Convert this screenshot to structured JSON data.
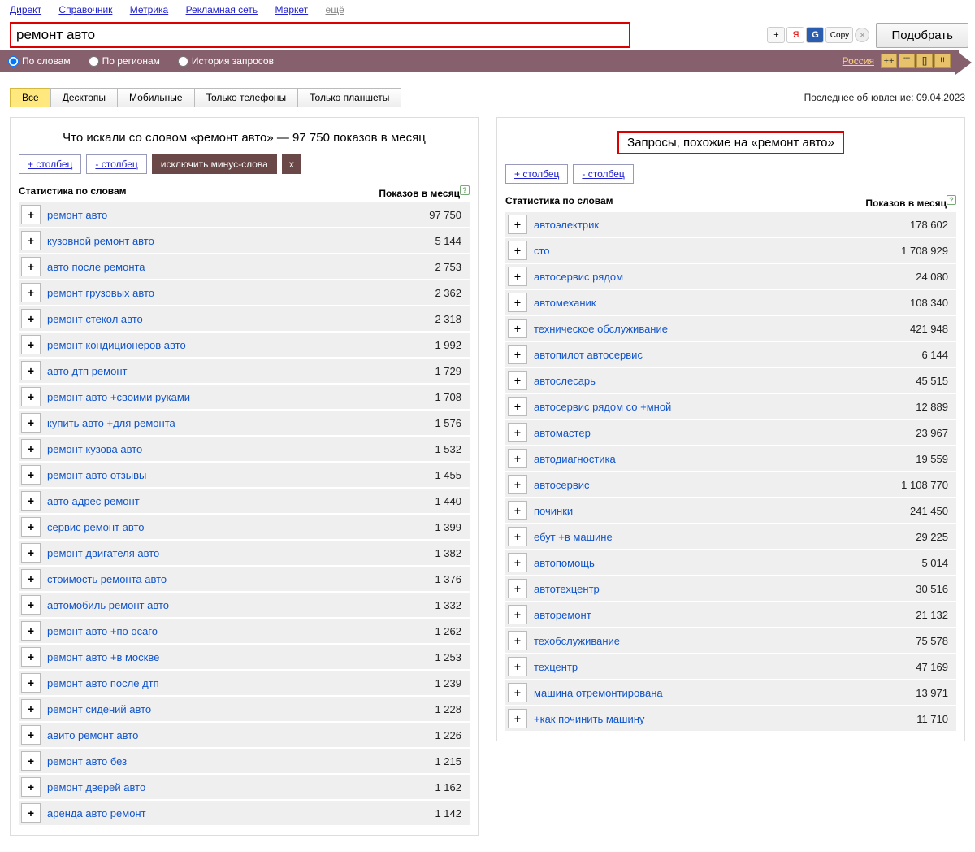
{
  "top_nav": [
    "Директ",
    "Справочник",
    "Метрика",
    "Рекламная сеть",
    "Маркет"
  ],
  "top_nav_more": "ещё",
  "search": {
    "value": "ремонт авто"
  },
  "aux": {
    "plus": "+",
    "y": "Я",
    "g": "G",
    "copy": "Copy",
    "x": "×"
  },
  "submit": "Подобрать",
  "radios": {
    "words": "По словам",
    "regions": "По регионам",
    "history": "История запросов"
  },
  "region": "Россия",
  "small_btns": [
    "++",
    "\"\"",
    "[]",
    "!!"
  ],
  "tabs": [
    "Все",
    "Десктопы",
    "Мобильные",
    "Только телефоны",
    "Только планшеты"
  ],
  "update_label": "Последнее обновление:",
  "update_date": "09.04.2023",
  "left": {
    "title": "Что искали со словом «ремонт авто» — 97 750 показов в месяц",
    "add_col": "+ столбец",
    "del_col": "- столбец",
    "exclude": "исключить минус-слова",
    "exclude_x": "x",
    "head_left": "Статистика по словам",
    "head_right": "Показов в месяц",
    "rows": [
      {
        "kw": "ремонт авто",
        "n": "97 750"
      },
      {
        "kw": "кузовной ремонт авто",
        "n": "5 144"
      },
      {
        "kw": "авто после ремонта",
        "n": "2 753"
      },
      {
        "kw": "ремонт грузовых авто",
        "n": "2 362"
      },
      {
        "kw": "ремонт стекол авто",
        "n": "2 318"
      },
      {
        "kw": "ремонт кондиционеров авто",
        "n": "1 992"
      },
      {
        "kw": "авто дтп ремонт",
        "n": "1 729"
      },
      {
        "kw": "ремонт авто +своими руками",
        "n": "1 708"
      },
      {
        "kw": "купить авто +для ремонта",
        "n": "1 576"
      },
      {
        "kw": "ремонт кузова авто",
        "n": "1 532"
      },
      {
        "kw": "ремонт авто отзывы",
        "n": "1 455"
      },
      {
        "kw": "авто адрес ремонт",
        "n": "1 440"
      },
      {
        "kw": "сервис ремонт авто",
        "n": "1 399"
      },
      {
        "kw": "ремонт двигателя авто",
        "n": "1 382"
      },
      {
        "kw": "стоимость ремонта авто",
        "n": "1 376"
      },
      {
        "kw": "автомобиль ремонт авто",
        "n": "1 332"
      },
      {
        "kw": "ремонт авто +по осаго",
        "n": "1 262"
      },
      {
        "kw": "ремонт авто +в москве",
        "n": "1 253"
      },
      {
        "kw": "ремонт авто после дтп",
        "n": "1 239"
      },
      {
        "kw": "ремонт сидений авто",
        "n": "1 228"
      },
      {
        "kw": "авито ремонт авто",
        "n": "1 226"
      },
      {
        "kw": "ремонт авто без",
        "n": "1 215"
      },
      {
        "kw": "ремонт дверей авто",
        "n": "1 162"
      },
      {
        "kw": "аренда авто ремонт",
        "n": "1 142"
      }
    ]
  },
  "right": {
    "title": "Запросы, похожие на «ремонт авто»",
    "add_col": "+ столбец",
    "del_col": "- столбец",
    "head_left": "Статистика по словам",
    "head_right": "Показов в месяц",
    "rows": [
      {
        "kw": "автоэлектрик",
        "n": "178 602"
      },
      {
        "kw": "сто",
        "n": "1 708 929"
      },
      {
        "kw": "автосервис рядом",
        "n": "24 080"
      },
      {
        "kw": "автомеханик",
        "n": "108 340"
      },
      {
        "kw": "техническое обслуживание",
        "n": "421 948"
      },
      {
        "kw": "автопилот автосервис",
        "n": "6 144"
      },
      {
        "kw": "автослесарь",
        "n": "45 515"
      },
      {
        "kw": "автосервис рядом со +мной",
        "n": "12 889"
      },
      {
        "kw": "автомастер",
        "n": "23 967"
      },
      {
        "kw": "автодиагностика",
        "n": "19 559"
      },
      {
        "kw": "автосервис",
        "n": "1 108 770"
      },
      {
        "kw": "починки",
        "n": "241 450"
      },
      {
        "kw": "ебут +в машине",
        "n": "29 225"
      },
      {
        "kw": "автопомощь",
        "n": "5 014"
      },
      {
        "kw": "автотехцентр",
        "n": "30 516"
      },
      {
        "kw": "авторемонт",
        "n": "21 132"
      },
      {
        "kw": "техобслуживание",
        "n": "75 578"
      },
      {
        "kw": "техцентр",
        "n": "47 169"
      },
      {
        "kw": "машина отремонтирована",
        "n": "13 971"
      },
      {
        "kw": "+как починить машину",
        "n": "11 710"
      }
    ]
  },
  "help": "?"
}
